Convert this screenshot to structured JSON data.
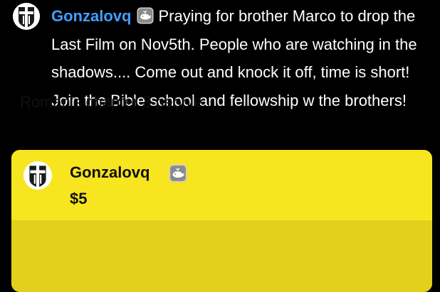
{
  "chat": {
    "username": "Gonzalovq",
    "message": "Praying for brother Marco to drop the Last Film on Nov5th. People who are watching in the shadows.... Come out and knock it off, time is short! Join the Bible school and fellowship w the brothers!",
    "username_color": "#3fa0ff"
  },
  "donation": {
    "username": "Gonzalovq",
    "amount": "$5",
    "message": "Roman’s chapter 3 people",
    "header_color": "#f7e520",
    "body_color": "#e3d01c"
  },
  "icons": {
    "avatar": "cross-shield-icon",
    "badge": "whale-badge-icon"
  }
}
